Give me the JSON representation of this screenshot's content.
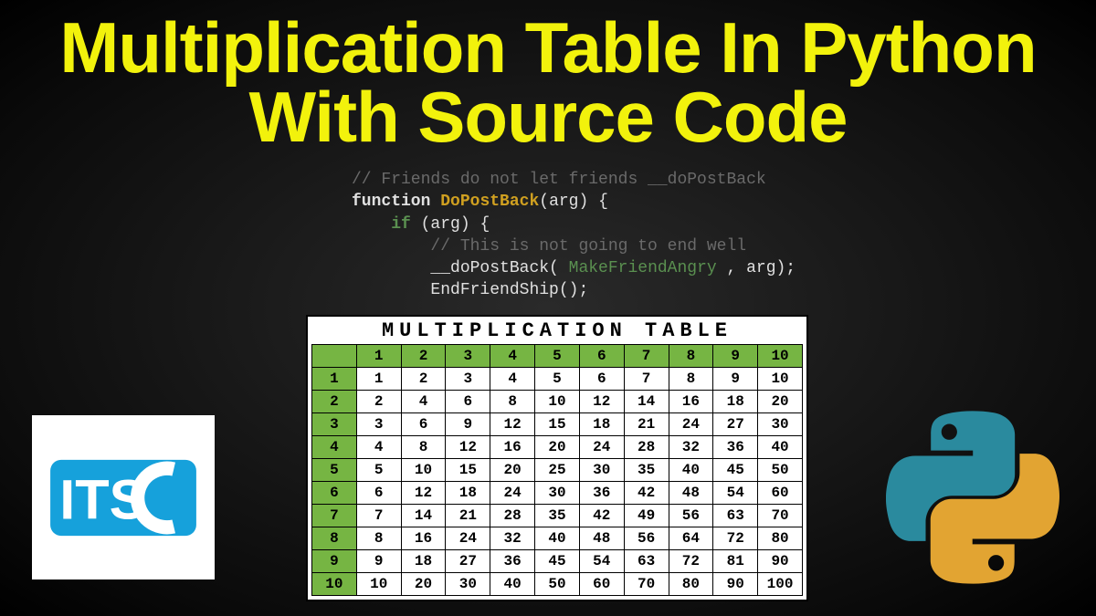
{
  "title_line1": "Multiplication Table In Python",
  "title_line2": "With Source Code",
  "code": {
    "l1": "// Friends do not let friends __doPostBack",
    "l2_kw": "function",
    "l2_fn": "DoPostBack",
    "l2_rest": "(arg) {",
    "l3_if": "if",
    "l3_rest": " (arg) {",
    "l4": "// This is not going to end well",
    "l5_call": "__doPostBack",
    "l5_arg": "MakeFriendAngry",
    "l5_rest1": "( ",
    "l5_rest2": " , arg);",
    "l6": "EndFriendShip();"
  },
  "chart_data": {
    "type": "table",
    "title": "MULTIPLICATION TABLE",
    "columns": [
      1,
      2,
      3,
      4,
      5,
      6,
      7,
      8,
      9,
      10
    ],
    "rows": [
      {
        "h": 1,
        "v": [
          1,
          2,
          3,
          4,
          5,
          6,
          7,
          8,
          9,
          10
        ]
      },
      {
        "h": 2,
        "v": [
          2,
          4,
          6,
          8,
          10,
          12,
          14,
          16,
          18,
          20
        ]
      },
      {
        "h": 3,
        "v": [
          3,
          6,
          9,
          12,
          15,
          18,
          21,
          24,
          27,
          30
        ]
      },
      {
        "h": 4,
        "v": [
          4,
          8,
          12,
          16,
          20,
          24,
          28,
          32,
          36,
          40
        ]
      },
      {
        "h": 5,
        "v": [
          5,
          10,
          15,
          20,
          25,
          30,
          35,
          40,
          45,
          50
        ]
      },
      {
        "h": 6,
        "v": [
          6,
          12,
          18,
          24,
          30,
          36,
          42,
          48,
          54,
          60
        ]
      },
      {
        "h": 7,
        "v": [
          7,
          14,
          21,
          28,
          35,
          42,
          49,
          56,
          63,
          70
        ]
      },
      {
        "h": 8,
        "v": [
          8,
          16,
          24,
          32,
          40,
          48,
          56,
          64,
          72,
          80
        ]
      },
      {
        "h": 9,
        "v": [
          9,
          18,
          27,
          36,
          45,
          54,
          63,
          72,
          81,
          90
        ]
      },
      {
        "h": 10,
        "v": [
          10,
          20,
          30,
          40,
          50,
          60,
          70,
          80,
          90,
          100
        ]
      }
    ]
  },
  "logos": {
    "itsc": "ITSC",
    "python": "python-icon"
  }
}
